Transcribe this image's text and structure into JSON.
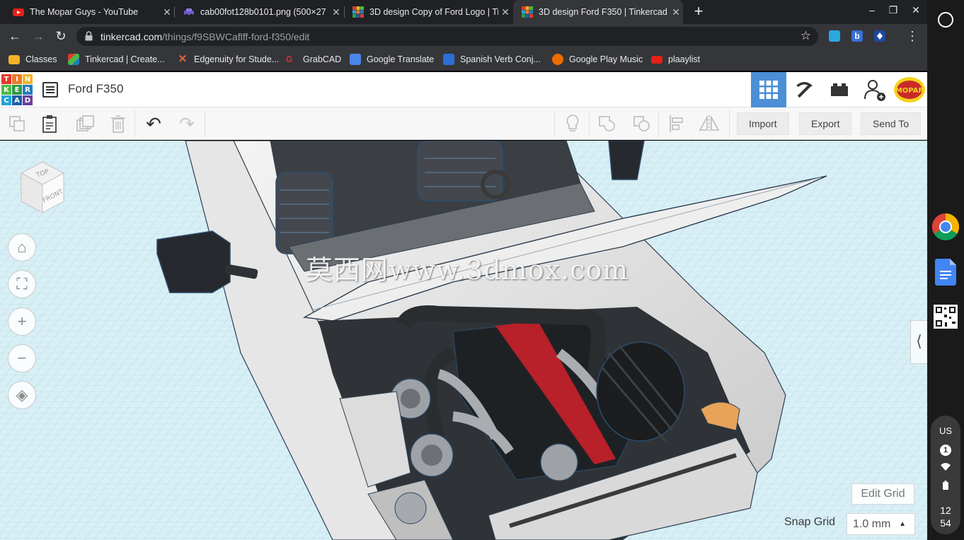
{
  "browser": {
    "tabs": [
      {
        "title": "The Mopar Guys - YouTube",
        "icon": "youtube-icon"
      },
      {
        "title": "cab00fot128b0101.png (500×27",
        "icon": "car-image-icon"
      },
      {
        "title": "3D design Copy of Ford Logo | Ti",
        "icon": "tinkercad-icon"
      },
      {
        "title": "3D design Ford F350 | Tinkercad",
        "icon": "tinkercad-icon"
      }
    ],
    "new_tab": "+",
    "window_controls": {
      "minimize": "–",
      "restore": "❐",
      "close": "✕"
    },
    "nav": {
      "back": "←",
      "forward": "→",
      "reload": "↻"
    },
    "address": {
      "host": "tinkercad.com",
      "path": "/things/f9SBWCaflff-ford-f350/edit"
    },
    "bookmark_star": "☆",
    "menu": "⋮",
    "bookmarks": [
      {
        "label": "Classes",
        "icon": "folder-icon"
      },
      {
        "label": "Tinkercad | Create...",
        "icon": "tinkercad-icon"
      },
      {
        "label": "Edgenuity for Stude...",
        "icon": "edgenuity-icon"
      },
      {
        "label": "GrabCAD",
        "icon": "grabcad-icon"
      },
      {
        "label": "Google Translate",
        "icon": "translate-icon"
      },
      {
        "label": "Spanish Verb Conj...",
        "icon": "spanish-verb-icon"
      },
      {
        "label": "Google Play Music",
        "icon": "play-music-icon"
      },
      {
        "label": "plaaylist",
        "icon": "youtube-icon"
      }
    ]
  },
  "tinkercad": {
    "logo_letters": [
      "T",
      "I",
      "N",
      "K",
      "E",
      "R",
      "C",
      "A",
      "D"
    ],
    "design_title": "Ford F350",
    "header_buttons": [
      "3d-design-icon",
      "codeblocks-pickaxe-icon",
      "bricks-icon",
      "add-user-icon",
      "profile-avatar"
    ],
    "avatar_text": "MOPAR",
    "toolbar": {
      "import": "Import",
      "export": "Export",
      "send_to": "Send To"
    },
    "undo": "↶",
    "redo": "↷"
  },
  "viewport": {
    "viewcube": {
      "top": "TOP",
      "front": "FRONT"
    },
    "view_buttons": {
      "home": "⌂",
      "fit": "⛶",
      "zoom_in": "+",
      "zoom_out": "−",
      "ortho": "◈"
    },
    "watermark": "莫西网www.3dmox.com",
    "collapse": "⟨",
    "edit_grid": "Edit Grid",
    "snap_grid_label": "Snap Grid",
    "snap_grid_value": "1.0 mm",
    "snap_caret": "▲"
  },
  "shelf": {
    "apps": [
      "chrome-icon",
      "google-docs-icon",
      "qr-code-icon"
    ],
    "status": {
      "ime": "US",
      "notifications": "1",
      "time_hour": "12",
      "time_min": "54"
    }
  },
  "colors": {
    "tinkercad_blue": "#4b8fd6",
    "logo": [
      "#e2382b",
      "#ee7a2b",
      "#f2b32a",
      "#4eb847",
      "#2f9b47",
      "#1f7fc0",
      "#24a3d8",
      "#1c5fa8",
      "#6b3fa0"
    ],
    "grid": "#bfe3ec"
  }
}
